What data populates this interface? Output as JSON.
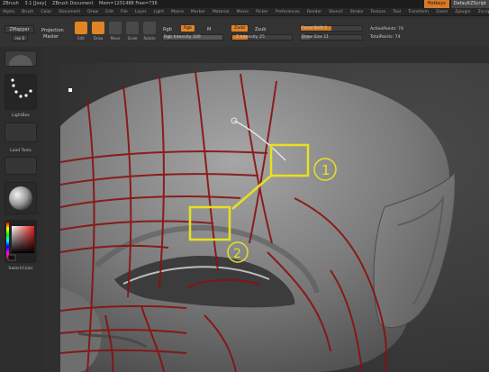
{
  "titlebar": {
    "app": "ZBrush",
    "version": "3.1 [Joey]",
    "doc": "ZBrush Document",
    "mem": "Mem=1251488 Free=736",
    "help_button": "Hotkeys",
    "script_button": "DefaultZScript"
  },
  "menubar": {
    "items": [
      "Alpha",
      "Brush",
      "Color",
      "Document",
      "Draw",
      "Edit",
      "File",
      "Layer",
      "Light",
      "Macro",
      "Marker",
      "Material",
      "Movie",
      "Picker",
      "Preferences",
      "Render",
      "Stencil",
      "Stroke",
      "Texture",
      "Tool",
      "Transform",
      "Zoom",
      "Zplugin",
      "Zscript"
    ]
  },
  "shelf": {
    "zmapper_button": "ZMapper",
    "projection_label": "Projection",
    "projection_value": "Master",
    "tools": [
      "Edit",
      "Draw",
      "Move",
      "Scale",
      "Rotate"
    ],
    "edit_active": true,
    "draw_active": true,
    "rgb_label": "Rgb",
    "rgb_pill": "Rgb",
    "m_label": "M",
    "rgb_intensity": "Rgb Intensity 100",
    "zadd": "Zadd",
    "zsub": "Zsub",
    "z_intensity": "Z Intensity 25",
    "focal_shift": "Focal Shift 0",
    "draw_size": "Draw Size 11",
    "active_points": "ActivePoints: 74",
    "total_points": "TotalPoints: 74"
  },
  "leftbar": {
    "lightbox_label": "LightBox",
    "load_tools_label": "Load Tools",
    "switch_color_label": "SwitchColor"
  },
  "annotations": {
    "label_one": "1",
    "label_two": "2"
  },
  "colors": {
    "accent": "#e08424",
    "annotation": "#e8e020",
    "polygroup_lines": "#8a1010"
  }
}
